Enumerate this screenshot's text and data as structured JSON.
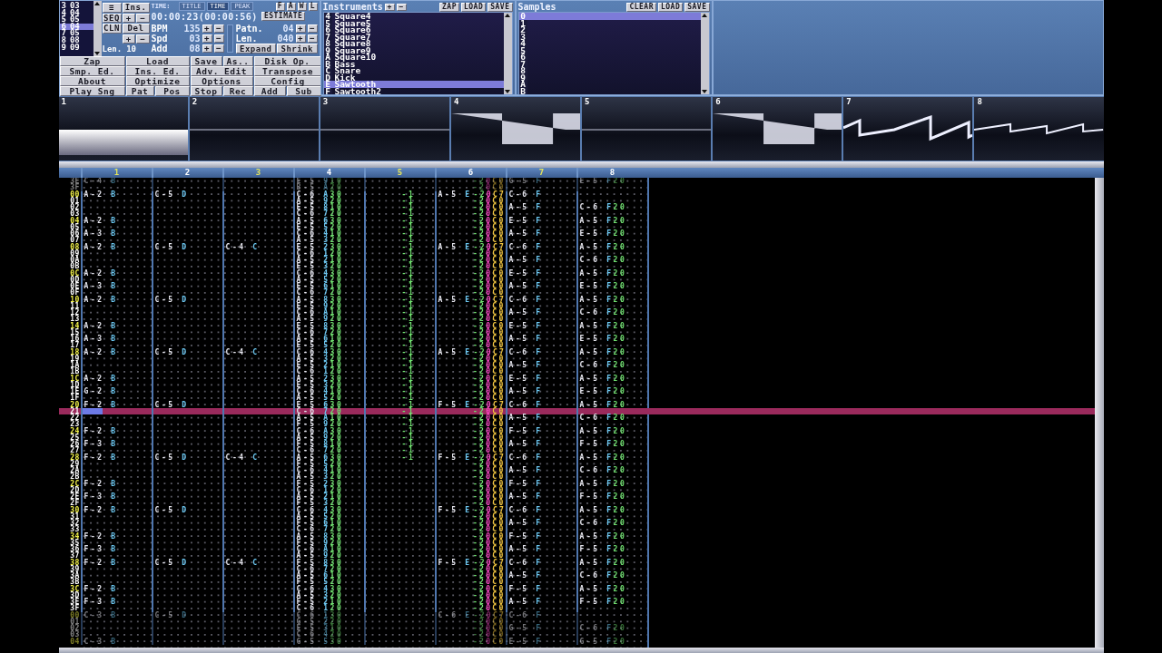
{
  "sequence": {
    "positions": [
      {
        "index": "3",
        "pattern": "03",
        "selected": false
      },
      {
        "index": "4",
        "pattern": "04",
        "selected": false
      },
      {
        "index": "5",
        "pattern": "05",
        "selected": false
      },
      {
        "index": "6",
        "pattern": "04",
        "selected": true
      },
      {
        "index": "7",
        "pattern": "05",
        "selected": false
      },
      {
        "index": "8",
        "pattern": "08",
        "selected": false
      },
      {
        "index": "9",
        "pattern": "09",
        "selected": false
      }
    ],
    "controls": {
      "menu": "≡",
      "insert": "Ins.",
      "seq": "SEQ",
      "insert_plus": "+",
      "insert_minus": "−",
      "cln": "CLN",
      "delete": "Del",
      "delete_plus": "+",
      "delete_minus": "−"
    },
    "length_label": "Len.",
    "length": "10"
  },
  "time": {
    "label": "TIME:",
    "tabs": [
      {
        "label": "TITLE",
        "selected": false
      },
      {
        "label": "TIME",
        "selected": true
      },
      {
        "label": "PEAK",
        "selected": false
      }
    ],
    "toggles": [
      "F",
      "A",
      "W",
      "L"
    ],
    "value": "00:00:23(00:00:56)",
    "estimate": "ESTIMATE"
  },
  "song": [
    {
      "label": "BPM",
      "value": "135",
      "plus": "+",
      "minus": "−"
    },
    {
      "label": "Spd",
      "value": "03",
      "plus": "+",
      "minus": "−"
    },
    {
      "label": "Add",
      "value": "08",
      "plus": "+",
      "minus": "−"
    }
  ],
  "pattern_info": {
    "fields": [
      {
        "label": "Patn.",
        "value": "04",
        "plus": "+",
        "minus": "−"
      },
      {
        "label": "Len.",
        "value": "040",
        "plus": "+",
        "minus": "−"
      }
    ],
    "expand": "Expand",
    "shrink": "Shrink"
  },
  "main_buttons": [
    [
      "Zap",
      "Load",
      "Save",
      "As..",
      "Disk Op."
    ],
    [
      "Smp. Ed.",
      "Ins. Ed.",
      "Adv. Edit",
      "Transpose"
    ],
    [
      "About",
      "Optimize",
      "Options",
      "Config"
    ],
    [
      "Play Sng",
      "Pat",
      "Pos",
      "Stop",
      "Rec",
      "Add",
      "Sub"
    ]
  ],
  "instruments": {
    "title": "Instruments",
    "plus": "+",
    "minus": "−",
    "buttons": [
      "ZAP",
      "LOAD",
      "SAVE"
    ],
    "items": [
      {
        "index": "4",
        "name": "Square4",
        "selected": false
      },
      {
        "index": "5",
        "name": "Square5",
        "selected": false
      },
      {
        "index": "6",
        "name": "Square6",
        "selected": false
      },
      {
        "index": "7",
        "name": "Square7",
        "selected": false
      },
      {
        "index": "8",
        "name": "Square8",
        "selected": false
      },
      {
        "index": "9",
        "name": "Square9",
        "selected": false
      },
      {
        "index": "A",
        "name": "Square10",
        "selected": false
      },
      {
        "index": "B",
        "name": "Bass",
        "selected": false
      },
      {
        "index": "C",
        "name": "Snare",
        "selected": false
      },
      {
        "index": "D",
        "name": "Kick",
        "selected": false
      },
      {
        "index": "E",
        "name": "Sawtooth",
        "selected": true
      },
      {
        "index": "F",
        "name": "Sawtooth2",
        "selected": false
      }
    ]
  },
  "samples": {
    "title": "Samples",
    "buttons": [
      "CLEAR",
      "LOAD",
      "SAVE"
    ],
    "items": [
      {
        "index": "0",
        "selected": true
      },
      {
        "index": "1",
        "selected": false
      },
      {
        "index": "2",
        "selected": false
      },
      {
        "index": "3",
        "selected": false
      },
      {
        "index": "4",
        "selected": false
      },
      {
        "index": "5",
        "selected": false
      },
      {
        "index": "6",
        "selected": false
      },
      {
        "index": "7",
        "selected": false
      },
      {
        "index": "8",
        "selected": false
      },
      {
        "index": "9",
        "selected": false
      },
      {
        "index": "A",
        "selected": false
      },
      {
        "index": "B",
        "selected": false
      }
    ]
  },
  "scopes": [
    {
      "number": "1",
      "kind": "band"
    },
    {
      "number": "2",
      "kind": "flat"
    },
    {
      "number": "3",
      "kind": "flat"
    },
    {
      "number": "4",
      "kind": "square"
    },
    {
      "number": "5",
      "kind": "flat"
    },
    {
      "number": "6",
      "kind": "square"
    },
    {
      "number": "7",
      "kind": "saw"
    },
    {
      "number": "8",
      "kind": "ramp"
    }
  ],
  "pattern": {
    "channels": [
      "1",
      "2",
      "3",
      "4",
      "5",
      "6",
      "7",
      "8"
    ],
    "prev_rows": [
      {
        "row": "3E",
        "ch1": "C-4 B",
        "ch4": "E-5 910",
        "fx6": "-20C0",
        "ch7": "G-5 F",
        "ch8": "E-5 F20"
      },
      {
        "row": "3F",
        "ch4": "B-5 A20",
        "fx6": "-20C0"
      }
    ],
    "rows": [
      {
        "row": "00",
        "selected": false,
        "ch1": "A-2 B",
        "ch2": "C-5 D",
        "ch4": "C-6 A30",
        "ch5": "-1",
        "ch6": "A-5 E",
        "fx6": "-20C7",
        "ch7": "C-6 F"
      },
      {
        "row": "01",
        "selected": false,
        "ch4": "A-5 920",
        "ch5": "-1",
        "fx6": "-20C0"
      },
      {
        "row": "02",
        "selected": false,
        "ch4": "E-5 810",
        "ch5": "-1",
        "fx6": "-20C0",
        "ch7": "A-5 F",
        "ch8": "C-6 F20"
      },
      {
        "row": "03",
        "selected": false,
        "ch4": "C-6 720",
        "ch5": "-1",
        "fx6": "-20C0"
      },
      {
        "row": "04",
        "selected": false,
        "ch1": "A-2 B",
        "ch4": "A-5 630",
        "ch5": "-1",
        "fx6": "-20C0",
        "ch7": "E-5 F",
        "ch8": "A-5 F20"
      },
      {
        "row": "05",
        "selected": false,
        "ch4": "E-5 520",
        "ch5": "-1",
        "fx6": "-20C0"
      },
      {
        "row": "06",
        "selected": false,
        "ch1": "A-3 B",
        "ch4": "C-6 410",
        "ch5": "-1",
        "fx6": "-20C0",
        "ch7": "A-5 F",
        "ch8": "E-5 F20"
      },
      {
        "row": "07",
        "selected": false,
        "ch4": "A-5 320",
        "ch5": "-1",
        "fx6": "-20C0"
      },
      {
        "row": "08",
        "selected": false,
        "ch1": "A-2 B",
        "ch2": "C-5 D",
        "ch3": "C-4 C",
        "ch4": "E-5 230",
        "ch5": "-1",
        "ch6": "A-5 E",
        "fx6": "-20C7",
        "ch7": "C-6 F",
        "ch8": "A-5 F20"
      },
      {
        "row": "09",
        "selected": false,
        "ch4": "C-6 120",
        "ch5": "-1",
        "fx6": "-20C0"
      },
      {
        "row": "0A",
        "selected": false,
        "ch4": "A-5 210",
        "ch5": "-1",
        "fx6": "-20C0",
        "ch7": "A-5 F",
        "ch8": "C-6 F20"
      },
      {
        "row": "0B",
        "selected": false,
        "ch4": "E-5 320",
        "ch5": "-1",
        "fx6": "-20C0"
      },
      {
        "row": "0C",
        "selected": false,
        "ch1": "A-2 B",
        "ch4": "C-6 430",
        "ch5": "-1",
        "fx6": "-20C0",
        "ch7": "E-5 F",
        "ch8": "A-5 F20"
      },
      {
        "row": "0D",
        "selected": false,
        "ch4": "A-5 520",
        "ch5": "-1",
        "fx6": "-20C0"
      },
      {
        "row": "0E",
        "selected": false,
        "ch1": "A-3 B",
        "ch4": "E-5 610",
        "ch5": "-1",
        "fx6": "-20C0",
        "ch7": "A-5 F",
        "ch8": "E-5 F20"
      },
      {
        "row": "0F",
        "selected": false,
        "ch4": "C-6 720",
        "ch5": "-1",
        "fx6": "-20C0"
      },
      {
        "row": "10",
        "selected": false,
        "ch1": "A-2 B",
        "ch2": "C-5 D",
        "ch4": "A-5 830",
        "ch5": "-1",
        "ch6": "A-5 E",
        "fx6": "-20C7",
        "ch7": "C-6 F",
        "ch8": "A-5 F20"
      },
      {
        "row": "11",
        "selected": false,
        "ch4": "E-5 920",
        "ch5": "-1",
        "fx6": "-20C0"
      },
      {
        "row": "12",
        "selected": false,
        "ch4": "C-6 A10",
        "ch5": "-1",
        "fx6": "-20C0",
        "ch7": "A-5 F",
        "ch8": "C-6 F20"
      },
      {
        "row": "13",
        "selected": false,
        "ch4": "A-5 920",
        "ch5": "-1",
        "fx6": "-20C0"
      },
      {
        "row": "14",
        "selected": false,
        "ch1": "A-2 B",
        "ch4": "E-5 830",
        "ch5": "-1",
        "fx6": "-20C0",
        "ch7": "E-5 F",
        "ch8": "A-5 F20"
      },
      {
        "row": "15",
        "selected": false,
        "ch4": "C-6 720",
        "ch5": "-1",
        "fx6": "-20C0"
      },
      {
        "row": "16",
        "selected": false,
        "ch1": "A-3 B",
        "ch4": "A-5 610",
        "ch5": "-1",
        "fx6": "-20C0",
        "ch7": "A-5 F",
        "ch8": "E-5 F20"
      },
      {
        "row": "17",
        "selected": false,
        "ch4": "E-5 520",
        "ch5": "-1",
        "fx6": "-20C0"
      },
      {
        "row": "18",
        "selected": false,
        "ch1": "A-2 B",
        "ch2": "C-5 D",
        "ch3": "C-4 C",
        "ch4": "C-6 430",
        "ch5": "-1",
        "ch6": "A-5 E",
        "fx6": "-20C7",
        "ch7": "C-6 F",
        "ch8": "A-5 F20"
      },
      {
        "row": "19",
        "selected": false,
        "ch4": "A-5 320",
        "ch5": "-1",
        "fx6": "-20C0"
      },
      {
        "row": "1A",
        "selected": false,
        "ch4": "E-5 210",
        "ch5": "-1",
        "fx6": "-20C0",
        "ch7": "A-5 F",
        "ch8": "C-6 F20"
      },
      {
        "row": "1B",
        "selected": false,
        "ch4": "C-6 120",
        "ch5": "-1",
        "fx6": "-20C0"
      },
      {
        "row": "1C",
        "selected": false,
        "ch1": "A-2 B",
        "ch4": "A-5 230",
        "ch5": "-1",
        "fx6": "-20C0",
        "ch7": "E-5 F",
        "ch8": "A-5 F20"
      },
      {
        "row": "1D",
        "selected": false,
        "ch4": "E-5 320",
        "ch5": "-1",
        "fx6": "-20C0"
      },
      {
        "row": "1E",
        "selected": false,
        "ch1": "G-2 B",
        "ch4": "C-6 410",
        "ch5": "-1",
        "fx6": "-20C0",
        "ch7": "A-5 F",
        "ch8": "E-5 F20"
      },
      {
        "row": "1F",
        "selected": false,
        "ch4": "A-5 520",
        "ch5": "-1",
        "fx6": "-20C0"
      },
      {
        "row": "20",
        "selected": false,
        "ch1": "F-2 B",
        "ch2": "C-5 D",
        "ch4": "E-5 630",
        "ch5": "-1",
        "ch6": "F-5 E",
        "fx6": "-20C7",
        "ch7": "C-6 F",
        "ch8": "A-5 F20"
      },
      {
        "row": "21",
        "selected": true,
        "ch4": "C-6 720",
        "ch5": "-1",
        "fx6": "-20C0"
      },
      {
        "row": "22",
        "selected": false,
        "ch4": "A-5 A10",
        "ch5": "-1",
        "fx6": "-20C0",
        "ch7": "A-5 F",
        "ch8": "C-6 F20"
      },
      {
        "row": "23",
        "selected": false,
        "ch4": "F-5 920",
        "ch5": "-1",
        "fx6": "-20C0"
      },
      {
        "row": "24",
        "selected": false,
        "ch1": "F-2 B",
        "ch4": "C-6 A30",
        "ch5": "-1",
        "fx6": "-20C0",
        "ch7": "F-5 F",
        "ch8": "A-5 F20"
      },
      {
        "row": "25",
        "selected": false,
        "ch4": "A-5 920",
        "ch5": "-1",
        "fx6": "-20C0"
      },
      {
        "row": "26",
        "selected": false,
        "ch1": "F-3 B",
        "ch4": "F-5 810",
        "ch5": "-1",
        "fx6": "-20C0",
        "ch7": "A-5 F",
        "ch8": "F-5 F20"
      },
      {
        "row": "27",
        "selected": false,
        "ch4": "C-6 720",
        "ch5": "-1",
        "fx6": "-20C0"
      },
      {
        "row": "28",
        "selected": false,
        "ch1": "F-2 B",
        "ch2": "C-5 D",
        "ch3": "C-4 C",
        "ch4": "A-5 630",
        "ch5": "-1",
        "ch6": "F-5 E",
        "fx6": "-20C7",
        "ch7": "C-6 F",
        "ch8": "A-5 F20"
      },
      {
        "row": "29",
        "selected": false,
        "ch4": "F-5 520",
        "fx6": "-20C0"
      },
      {
        "row": "2A",
        "selected": false,
        "ch4": "C-6 410",
        "fx6": "-20C0",
        "ch7": "A-5 F",
        "ch8": "C-6 F20"
      },
      {
        "row": "2B",
        "selected": false,
        "ch4": "A-5 320",
        "fx6": "-20C0"
      },
      {
        "row": "2C",
        "selected": false,
        "ch1": "F-2 B",
        "ch4": "F-5 230",
        "fx6": "-20C0",
        "ch7": "F-5 F",
        "ch8": "A-5 F20"
      },
      {
        "row": "2D",
        "selected": false,
        "ch4": "C-6 120",
        "fx6": "-20C0"
      },
      {
        "row": "2E",
        "selected": false,
        "ch1": "F-3 B",
        "ch4": "A-5 210",
        "fx6": "-20C0",
        "ch7": "A-5 F",
        "ch8": "F-5 F20"
      },
      {
        "row": "2F",
        "selected": false,
        "ch4": "F-5 320",
        "fx6": "-20C0"
      },
      {
        "row": "30",
        "selected": false,
        "ch1": "F-2 B",
        "ch2": "C-5 D",
        "ch4": "C-6 430",
        "ch6": "F-5 E",
        "fx6": "-20C7",
        "ch7": "C-6 F",
        "ch8": "A-5 F20"
      },
      {
        "row": "31",
        "selected": false,
        "ch4": "A-5 520",
        "fx6": "-20C0"
      },
      {
        "row": "32",
        "selected": false,
        "ch4": "F-5 610",
        "fx6": "-20C0",
        "ch7": "A-5 F",
        "ch8": "C-6 F20"
      },
      {
        "row": "33",
        "selected": false,
        "ch4": "C-6 720",
        "fx6": "-20C0"
      },
      {
        "row": "34",
        "selected": false,
        "ch1": "F-2 B",
        "ch4": "A-5 830",
        "fx6": "-20C0",
        "ch7": "F-5 F",
        "ch8": "A-5 F20"
      },
      {
        "row": "35",
        "selected": false,
        "ch4": "F-5 920",
        "fx6": "-20C0"
      },
      {
        "row": "36",
        "selected": false,
        "ch1": "F-3 B",
        "ch4": "C-6 A10",
        "fx6": "-20C0",
        "ch7": "A-5 F",
        "ch8": "F-5 F20"
      },
      {
        "row": "37",
        "selected": false,
        "ch4": "A-5 920",
        "fx6": "-20C0"
      },
      {
        "row": "38",
        "selected": false,
        "ch1": "F-2 B",
        "ch2": "C-5 D",
        "ch3": "C-4 C",
        "ch4": "F-5 830",
        "ch6": "F-5 E",
        "fx6": "-20C7",
        "ch7": "C-6 F",
        "ch8": "A-5 F20"
      },
      {
        "row": "39",
        "selected": false,
        "ch4": "C-6 720",
        "fx6": "-20C0"
      },
      {
        "row": "3A",
        "selected": false,
        "ch4": "A-5 610",
        "fx6": "-20C0",
        "ch7": "A-5 F",
        "ch8": "C-6 F20"
      },
      {
        "row": "3B",
        "selected": false,
        "ch4": "F-5 520",
        "fx6": "-20C0"
      },
      {
        "row": "3C",
        "selected": false,
        "ch1": "F-2 B",
        "ch4": "C-6 430",
        "fx6": "-20C0",
        "ch7": "F-5 F",
        "ch8": "A-5 F20"
      },
      {
        "row": "3D",
        "selected": false,
        "ch4": "A-5 320",
        "fx6": "-20C0"
      },
      {
        "row": "3E",
        "selected": false,
        "ch1": "F-3 B",
        "ch4": "F-5 210",
        "fx6": "-20C0",
        "ch7": "A-5 F",
        "ch8": "F-5 F20"
      },
      {
        "row": "3F",
        "selected": false,
        "ch4": "C-6 120",
        "fx6": "-20C0"
      }
    ],
    "next_rows": [
      {
        "row": "00",
        "ch1": "C-3 B",
        "ch2": "C-5 D",
        "ch4": "C-6 130",
        "ch6": "C-6 E",
        "fx6": "-20C7",
        "ch7": "C-6 F"
      },
      {
        "row": "01",
        "ch4": "G-5 220",
        "fx6": "-20C0"
      },
      {
        "row": "02",
        "ch4": "E-5 310",
        "fx6": "-20C0",
        "ch7": "G-5 F",
        "ch8": "C-6 F20"
      },
      {
        "row": "03",
        "ch4": "C-6 420",
        "fx6": "-20C0"
      },
      {
        "row": "04",
        "ch1": "C-3 B",
        "ch4": "G-5 530",
        "fx6": "-20C0",
        "ch7": "E-5 F",
        "ch8": "G-5 F20"
      }
    ]
  }
}
